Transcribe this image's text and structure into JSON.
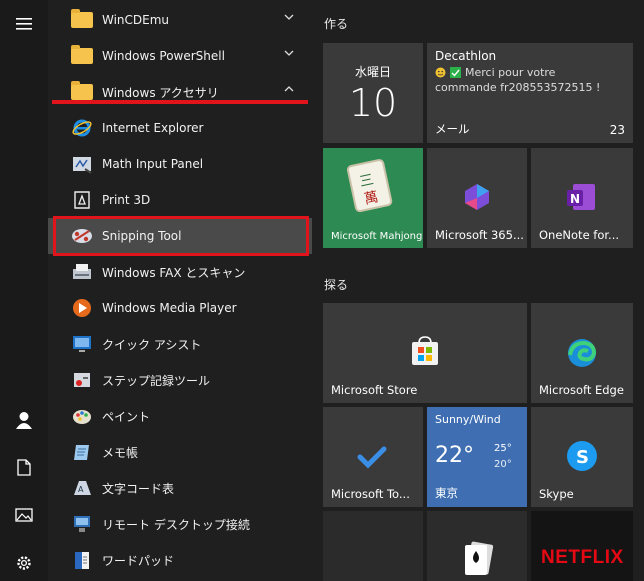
{
  "colors": {
    "accent_red": "#e0141a",
    "folder": "#f6c34c",
    "weather_tile": "#3f6fb2",
    "skype": "#1d9bf0",
    "netflix": "#e50914"
  },
  "rail": [
    {
      "icon": "hamburger-menu-icon"
    },
    {
      "icon": "user-icon"
    },
    {
      "icon": "document-icon"
    },
    {
      "icon": "pictures-icon"
    },
    {
      "icon": "gear-icon"
    }
  ],
  "app_list": [
    {
      "label": "WinCDEmu",
      "icon": "folder-icon",
      "chevron": "down"
    },
    {
      "label": "Windows PowerShell",
      "icon": "folder-icon",
      "chevron": "down"
    },
    {
      "label": "Windows アクセサリ",
      "icon": "folder-icon",
      "chevron": "up"
    },
    {
      "label": "Internet Explorer",
      "icon": "internet-explorer-icon"
    },
    {
      "label": "Math Input Panel",
      "icon": "math-input-icon"
    },
    {
      "label": "Print 3D",
      "icon": "print-3d-icon"
    },
    {
      "label": "Snipping Tool",
      "icon": "snipping-tool-icon",
      "selected": true
    },
    {
      "label": "Windows FAX とスキャン",
      "icon": "fax-scan-icon"
    },
    {
      "label": "Windows Media Player",
      "icon": "media-player-icon"
    },
    {
      "label": "クイック アシスト",
      "icon": "quick-assist-icon"
    },
    {
      "label": "ステップ記録ツール",
      "icon": "steps-recorder-icon"
    },
    {
      "label": "ペイント",
      "icon": "paint-icon"
    },
    {
      "label": "メモ帳",
      "icon": "notepad-icon"
    },
    {
      "label": "文字コード表",
      "icon": "character-map-icon"
    },
    {
      "label": "リモート デスクトップ接続",
      "icon": "remote-desktop-icon"
    },
    {
      "label": "ワードパッド",
      "icon": "wordpad-icon"
    }
  ],
  "groups": {
    "create": "作る",
    "explore": "探る"
  },
  "calendar": {
    "day": "水曜日",
    "date": "10"
  },
  "mail": {
    "from": "Decathlon",
    "line1": "Merci pour votre",
    "line2": "commande  fr208553572515 !",
    "label": "メール",
    "count": "23"
  },
  "tiles": {
    "mahjong": "Microsoft Mahjong",
    "m365": "Microsoft 365...",
    "onenote": "OneNote for...",
    "store": "Microsoft Store",
    "edge": "Microsoft Edge",
    "todo": "Microsoft To...",
    "skype": "Skype"
  },
  "weather": {
    "condition": "Sunny/Wind",
    "temp": "22°",
    "high": "25°",
    "low": "20°",
    "city": "東京"
  },
  "netflix": "NETFLIX"
}
